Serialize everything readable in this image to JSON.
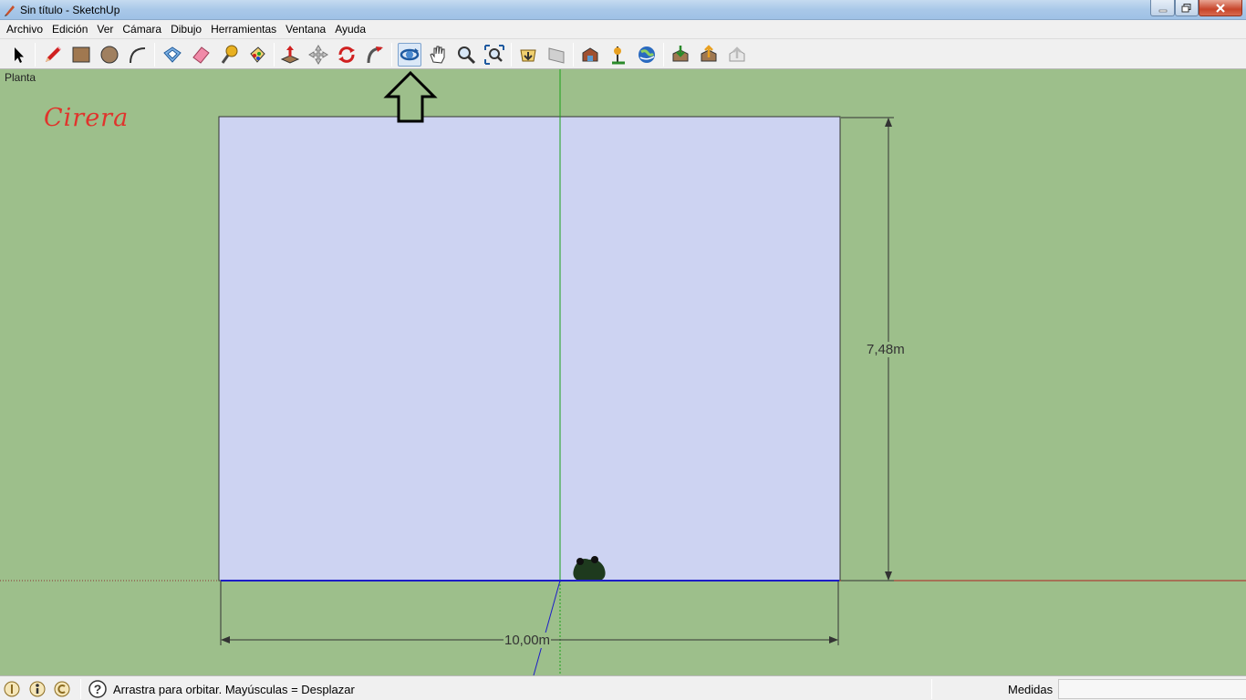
{
  "window": {
    "title": "Sin título - SketchUp"
  },
  "menu": [
    "Archivo",
    "Edición",
    "Ver",
    "Cámara",
    "Dibujo",
    "Herramientas",
    "Ventana",
    "Ayuda"
  ],
  "toolbar": {
    "tools": [
      {
        "name": "select-tool-button",
        "icon": "arrow-cursor-icon"
      },
      {
        "name": "line-tool-button",
        "icon": "pencil-icon"
      },
      {
        "name": "rectangle-tool-button",
        "icon": "rectangle-icon"
      },
      {
        "name": "circle-tool-button",
        "icon": "circle-icon"
      },
      {
        "name": "arc-tool-button",
        "icon": "arc-icon"
      },
      {
        "name": "make-component-button",
        "icon": "component-icon"
      },
      {
        "name": "eraser-tool-button",
        "icon": "eraser-icon"
      },
      {
        "name": "tape-measure-button",
        "icon": "tape-measure-icon"
      },
      {
        "name": "paint-bucket-button",
        "icon": "paint-bucket-icon"
      },
      {
        "name": "push-pull-button",
        "icon": "push-pull-icon"
      },
      {
        "name": "move-tool-button",
        "icon": "move-icon"
      },
      {
        "name": "rotate-tool-button",
        "icon": "rotate-icon"
      },
      {
        "name": "follow-me-button",
        "icon": "follow-me-icon"
      },
      {
        "name": "orbit-tool-button",
        "icon": "orbit-icon"
      },
      {
        "name": "pan-tool-button",
        "icon": "hand-icon"
      },
      {
        "name": "zoom-tool-button",
        "icon": "magnifier-icon"
      },
      {
        "name": "zoom-extents-button",
        "icon": "zoom-extents-icon"
      },
      {
        "name": "previous-view-button",
        "icon": "previous-view-icon"
      },
      {
        "name": "next-view-button",
        "icon": "next-view-icon"
      },
      {
        "name": "get-models-button",
        "icon": "warehouse-get-icon"
      },
      {
        "name": "add-location-button",
        "icon": "add-location-icon"
      },
      {
        "name": "google-earth-button",
        "icon": "google-earth-icon"
      },
      {
        "name": "get-photo-texture-button",
        "icon": "download-model-icon"
      },
      {
        "name": "share-model-button",
        "icon": "share-model-icon"
      },
      {
        "name": "share-component-button",
        "icon": "share-component-icon"
      }
    ],
    "active_tool": "orbit-tool-button"
  },
  "canvas": {
    "view_label": "Planta",
    "watermark": "Cirera",
    "dimension_width": "10,00m",
    "dimension_height": "7,48m",
    "colors": {
      "background": "#9dbf8b",
      "face": "#cdd3f2",
      "green_axis": "#1aa01a",
      "blue_axis": "#1c1cc8",
      "red_axis": "#b02020"
    }
  },
  "statusbar": {
    "hint": "Arrastra para orbitar. Mayúsculas = Desplazar",
    "measurements_label": "Medidas",
    "measurements_value": ""
  }
}
